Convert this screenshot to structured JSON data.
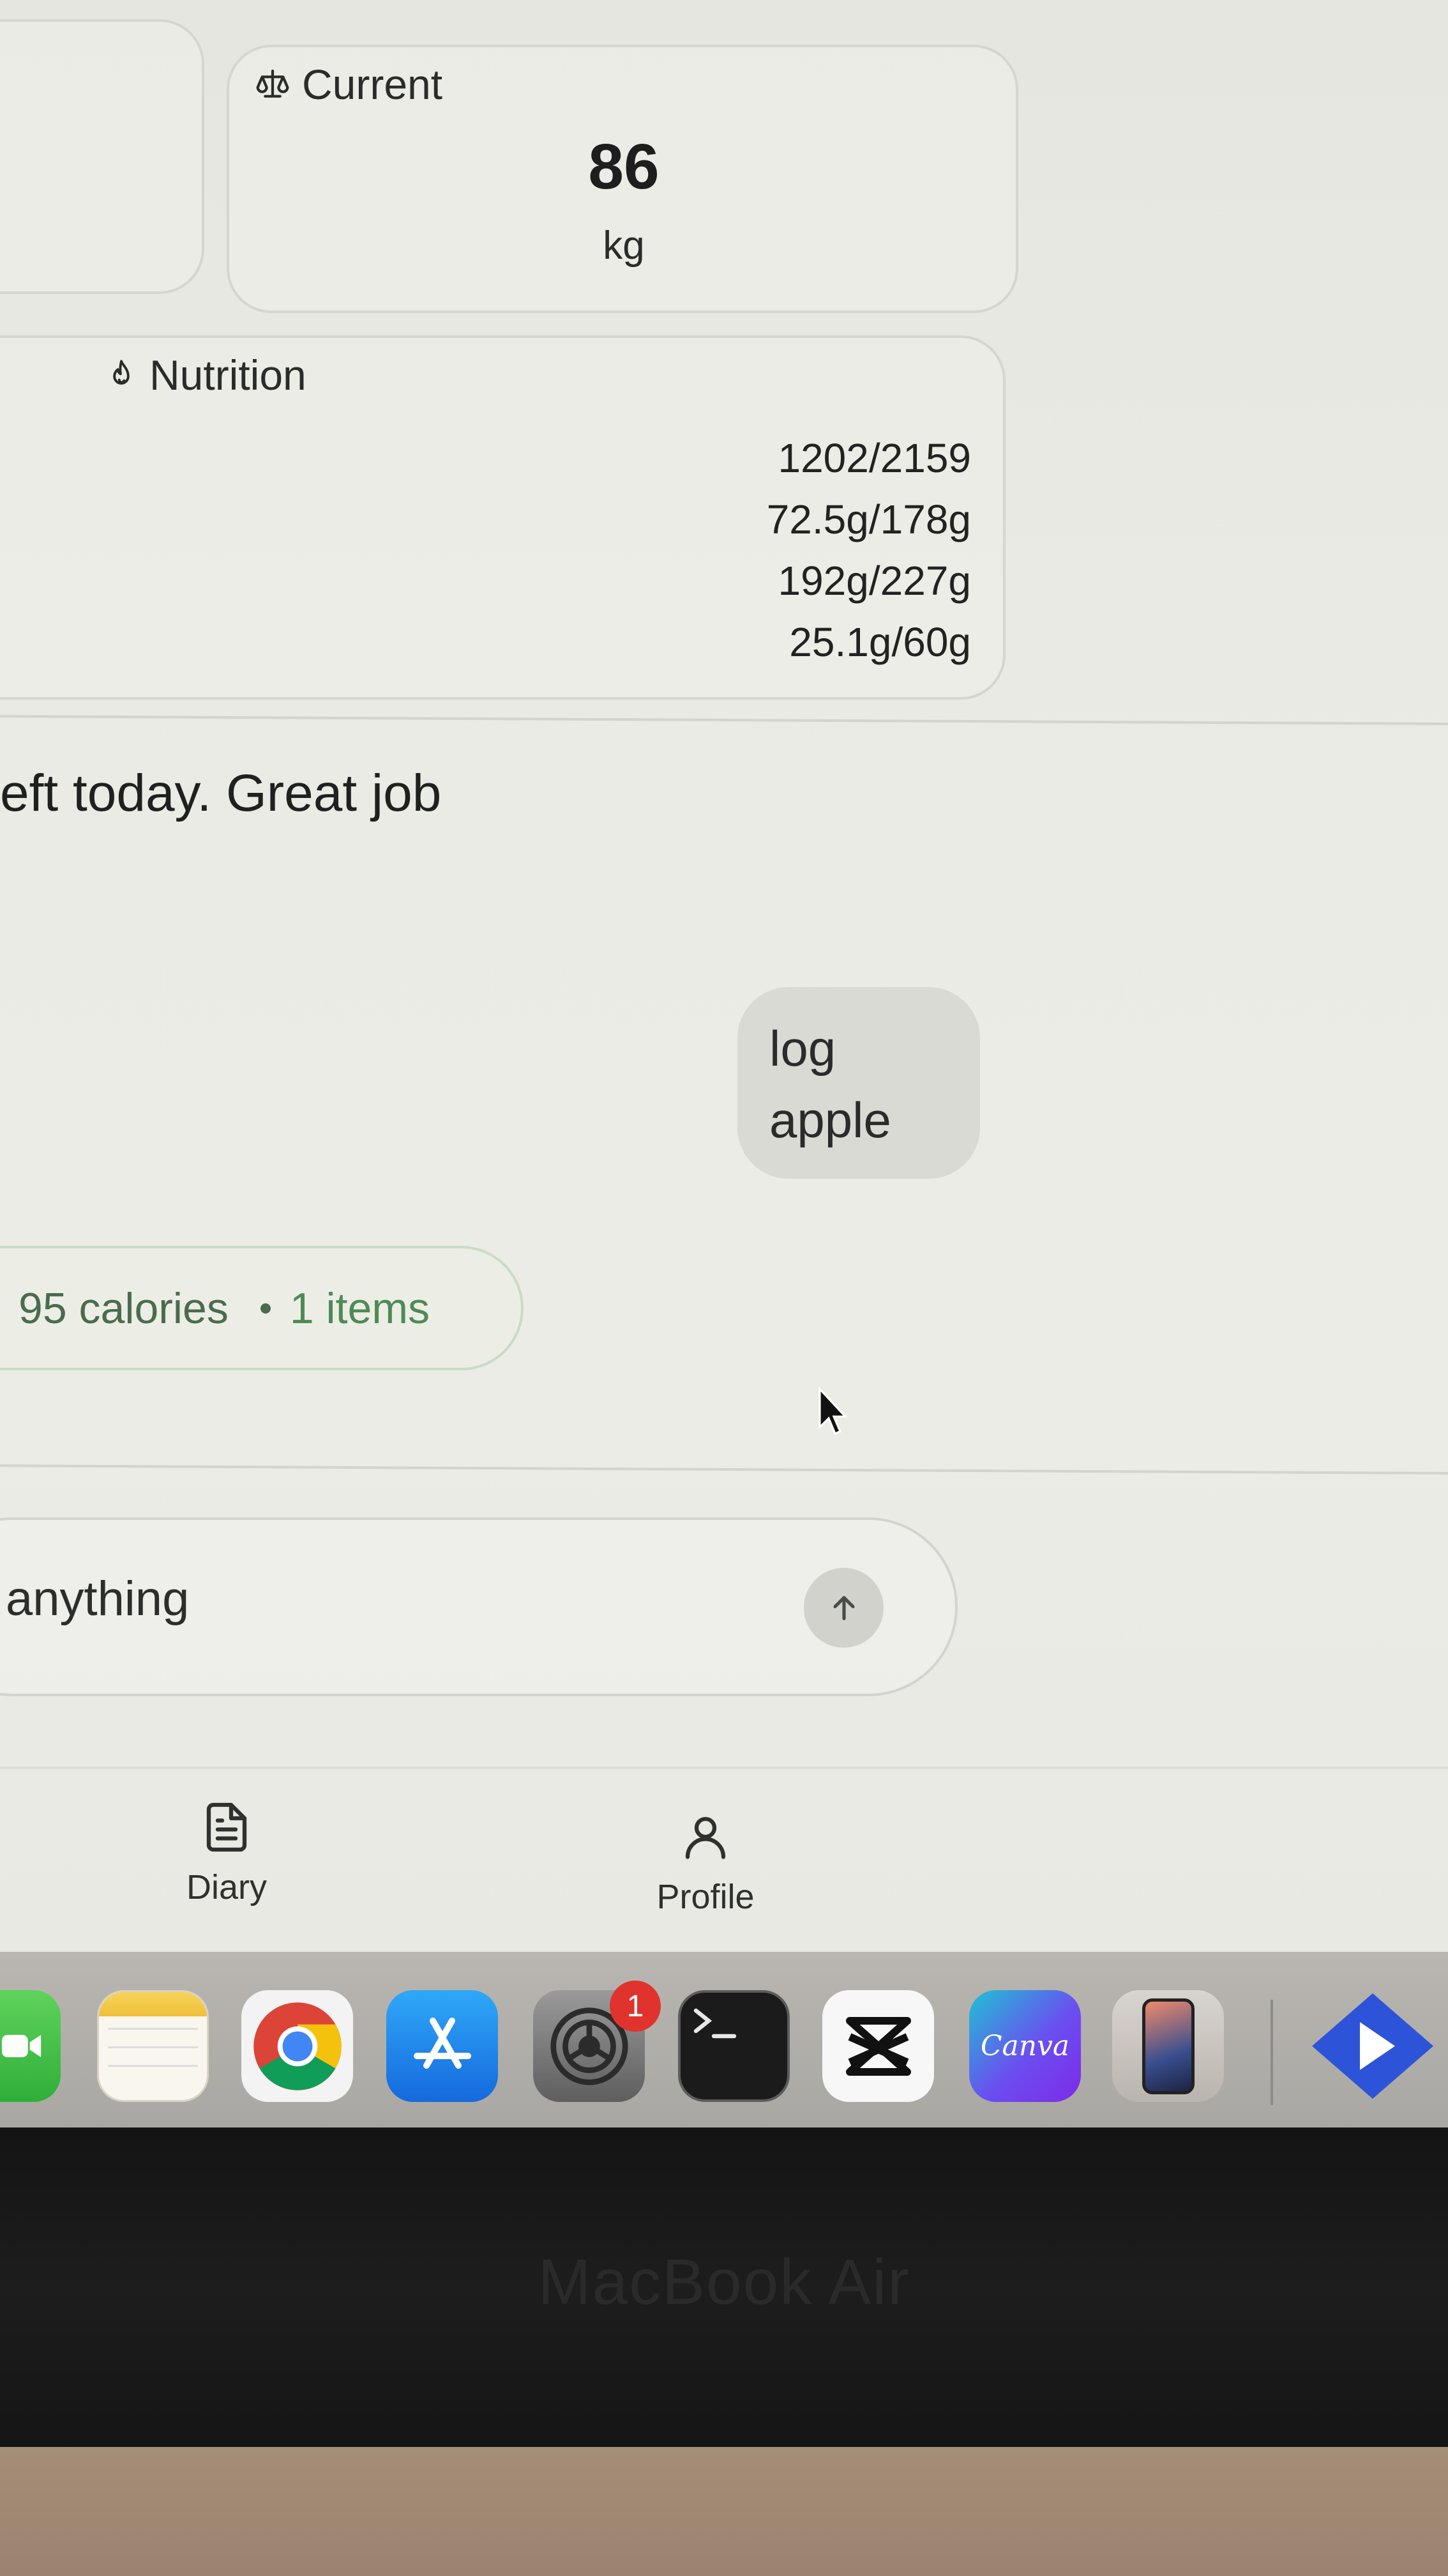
{
  "stats": {
    "current": {
      "title": "Current",
      "value": "86",
      "unit": "kg",
      "icon": "scale-icon"
    },
    "nutrition": {
      "title": "Nutrition",
      "icon": "flame-icon",
      "values": [
        "1202/2159",
        "72.5g/178g",
        "192g/227g",
        "25.1g/60g"
      ]
    }
  },
  "chat": {
    "assistant_message": "eft today. Great job",
    "user_message_line1": "log",
    "user_message_line2": "apple",
    "summary_calories": "95 calories",
    "summary_items": "1 items"
  },
  "composer": {
    "placeholder": "anything",
    "send_icon": "arrow-up-icon"
  },
  "bottom_nav": {
    "diary_label": "Diary",
    "profile_label": "Profile"
  },
  "dock": {
    "apps": [
      "FaceTime",
      "Notes",
      "Chrome",
      "App Store",
      "System Settings",
      "Terminal",
      "CapCut",
      "Canva",
      "iPhone Mirroring",
      "Prime Video"
    ],
    "settings_badge": "1",
    "canva_label": "Canva"
  },
  "device": {
    "bezel_label": "MacBook Air"
  },
  "colors": {
    "accent_green": "#4b6b4d",
    "badge_red": "#e0332d",
    "background": "#ebebe5"
  }
}
